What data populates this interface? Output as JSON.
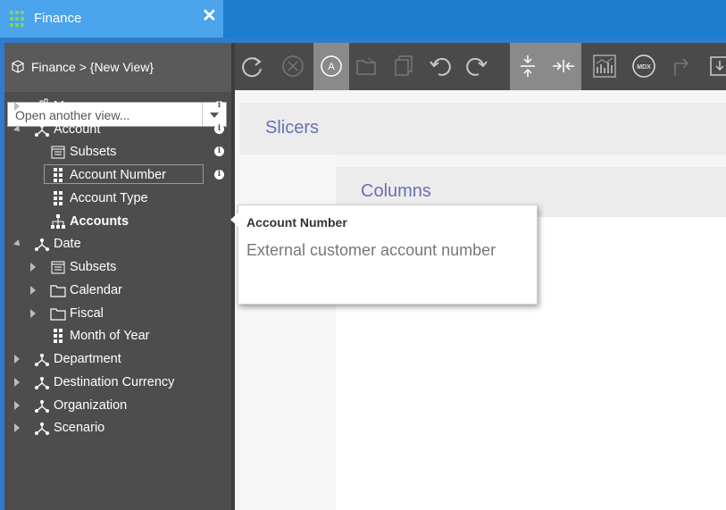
{
  "tab": {
    "title": "Finance",
    "close": "✕"
  },
  "sidebar": {
    "breadcrumb": "Finance > {New View}",
    "view_placeholder": "Open another view...",
    "tree": [
      {
        "label": "Measures",
        "icon": "measures-icon",
        "expander": "collapsed",
        "info": true,
        "bold": false
      },
      {
        "label": "Account",
        "icon": "dimension-icon",
        "expander": "expanded",
        "info": true,
        "bold": false
      },
      {
        "label": "Subsets",
        "icon": "subsets-icon",
        "expander": "none",
        "info": true,
        "bold": false
      },
      {
        "label": "Account Number",
        "icon": "attribute-icon",
        "expander": "none",
        "info": true,
        "bold": false,
        "selected": true
      },
      {
        "label": "Account Type",
        "icon": "attribute-icon",
        "expander": "none",
        "info": false,
        "bold": false
      },
      {
        "label": "Accounts",
        "icon": "hierarchy-icon",
        "expander": "none",
        "info": false,
        "bold": true
      },
      {
        "label": "Date",
        "icon": "dimension-icon",
        "expander": "expanded",
        "info": false,
        "bold": false
      },
      {
        "label": "Subsets",
        "icon": "subsets-icon",
        "expander": "collapsed",
        "info": false,
        "bold": false
      },
      {
        "label": "Calendar",
        "icon": "folder-icon",
        "expander": "collapsed",
        "info": false,
        "bold": false
      },
      {
        "label": "Fiscal",
        "icon": "folder-icon",
        "expander": "collapsed",
        "info": false,
        "bold": false
      },
      {
        "label": "Month of Year",
        "icon": "attribute-icon",
        "expander": "none",
        "info": false,
        "bold": false
      },
      {
        "label": "Department",
        "icon": "dimension-icon",
        "expander": "collapsed",
        "info": false,
        "bold": false
      },
      {
        "label": "Destination Currency",
        "icon": "dimension-icon",
        "expander": "collapsed",
        "info": false,
        "bold": false
      },
      {
        "label": "Organization",
        "icon": "dimension-icon",
        "expander": "collapsed",
        "info": false,
        "bold": false
      },
      {
        "label": "Scenario",
        "icon": "dimension-icon",
        "expander": "collapsed",
        "info": false,
        "bold": false
      }
    ]
  },
  "toolbar": {
    "buttons": [
      {
        "name": "refresh-icon",
        "active": false
      },
      {
        "name": "cancel-icon",
        "active": false
      },
      {
        "name": "automatic-recalc-icon",
        "active": true,
        "text": "A"
      },
      {
        "name": "open-folder-icon",
        "active": false
      },
      {
        "name": "copy-icon",
        "active": false
      },
      {
        "name": "undo-icon",
        "active": false
      },
      {
        "name": "redo-icon",
        "active": false
      },
      {
        "name": "suppress-zeros-icon",
        "active": true
      },
      {
        "name": "collapse-icon",
        "active": true
      },
      {
        "name": "chart-icon",
        "active": false
      },
      {
        "name": "mdx-icon",
        "active": false,
        "text": "MDX"
      },
      {
        "name": "export-icon",
        "active": false
      },
      {
        "name": "save-icon",
        "active": false
      }
    ]
  },
  "main": {
    "slicers_title": "Slicers",
    "columns_title": "Columns"
  },
  "tooltip": {
    "title": "Account Number",
    "description": "External customer account number"
  }
}
